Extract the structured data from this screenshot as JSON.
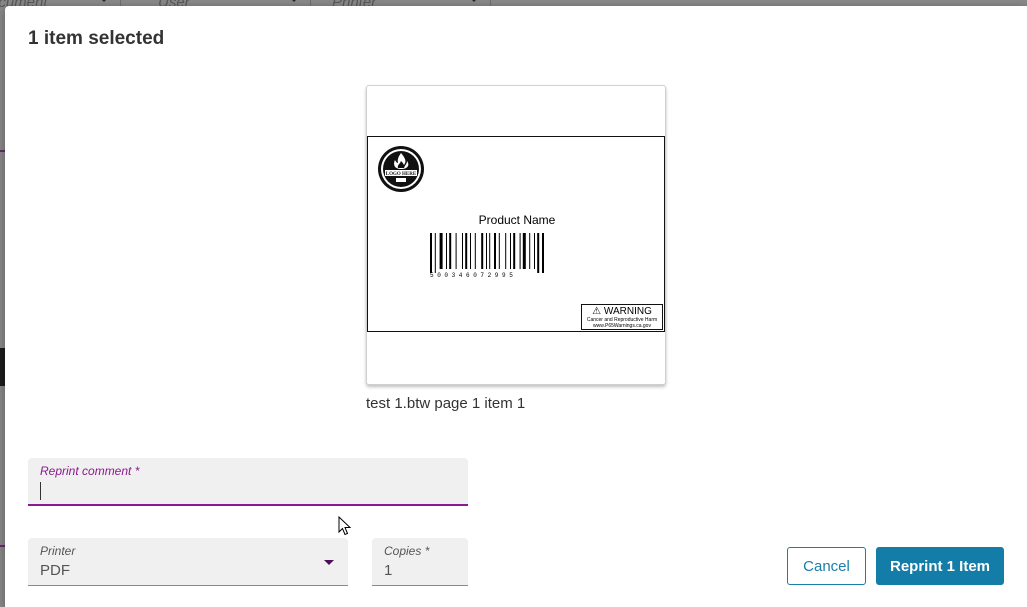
{
  "background": {
    "filters": [
      "ocument",
      "User",
      "Printer"
    ]
  },
  "dialog": {
    "title": "1 item selected",
    "preview": {
      "product_name": "Product Name",
      "barcode_digits": "5   0 0 3 4 6   0 7 2 9 9   5",
      "logo_text": "LOGO HERE",
      "warning_title": "WARNING",
      "warning_sub": "Cancer and Reproductive Harm",
      "warning_url": "www.P65Warnings.ca.gov",
      "caption": "test 1.btw page 1 item 1"
    },
    "reprint_comment": {
      "label": "Reprint comment *",
      "value": ""
    },
    "printer": {
      "label": "Printer",
      "value": "PDF"
    },
    "copies": {
      "label": "Copies *",
      "value": "1"
    },
    "buttons": {
      "cancel": "Cancel",
      "reprint": "Reprint 1 Item"
    },
    "colors": {
      "accent": "#8a1a8f",
      "primary": "#137da7"
    }
  }
}
